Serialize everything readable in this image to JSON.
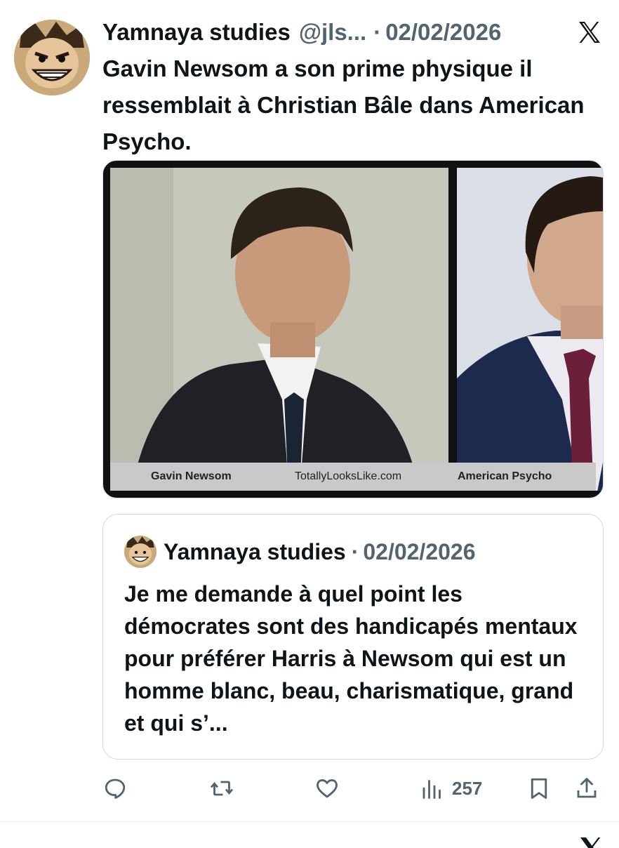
{
  "tweet": {
    "author_name": "Yamnaya studies",
    "handle": "@jls...",
    "separator": "·",
    "date": "02/02/2026",
    "text": "Gavin Newsom a son prime physique il ressemblait à Christian Bâle dans American Psycho.",
    "platform_icon": "x-logo-icon",
    "avatar_icon": "avatar-icon"
  },
  "media": {
    "caption_left": "Gavin Newsom",
    "caption_center": "TotallyLooksLike.com",
    "caption_right": "American Psycho"
  },
  "quoted_tweet": {
    "author_name": "Yamnaya studies",
    "separator": "·",
    "date": "02/02/2026",
    "text": "Je me demande à quel point les démocrates sont des handicapés mentaux pour préférer Harris à Newsom qui est un homme blanc, beau, charismatique, grand et qui s’..."
  },
  "actions": {
    "reply_icon": "reply-icon",
    "retweet_icon": "retweet-icon",
    "like_icon": "heart-icon",
    "views_icon": "views-icon",
    "views_count": "257",
    "bookmark_icon": "bookmark-icon",
    "share_icon": "share-icon"
  },
  "colors": {
    "text_primary": "#0f1419",
    "text_secondary": "#536471",
    "border": "#cfd9de"
  }
}
